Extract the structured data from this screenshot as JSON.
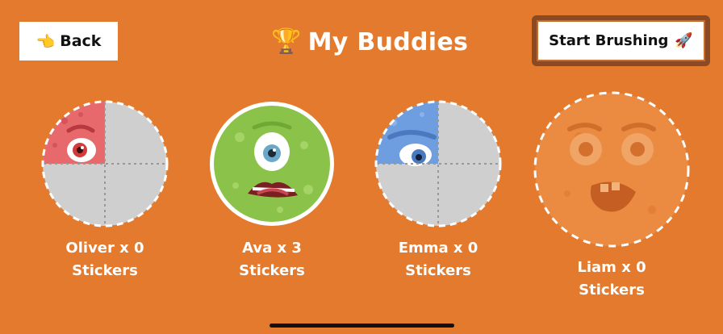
{
  "header": {
    "back_label": "Back",
    "back_icon": "👈",
    "title": "My Buddies",
    "title_icon": "🏆",
    "start_label": "Start Brushing",
    "start_icon": "🚀"
  },
  "buddies": [
    {
      "name_line": "Oliver x 0",
      "stickers_line": "Stickers",
      "color": "#e8696b",
      "collected_quarters": 1
    },
    {
      "name_line": "Ava x 3",
      "stickers_line": "Stickers",
      "color": "#8bc34a",
      "collected_quarters": 4
    },
    {
      "name_line": "Emma x 0",
      "stickers_line": "Stickers",
      "color": "#6f9ee0",
      "collected_quarters": 1
    },
    {
      "name_line": "Liam x 0",
      "stickers_line": "Stickers",
      "color": "#e8893c",
      "collected_quarters": 0
    }
  ],
  "colors": {
    "background": "#e37a2e",
    "button_border": "#8a4a24",
    "empty_slot": "#cfcfcf"
  }
}
